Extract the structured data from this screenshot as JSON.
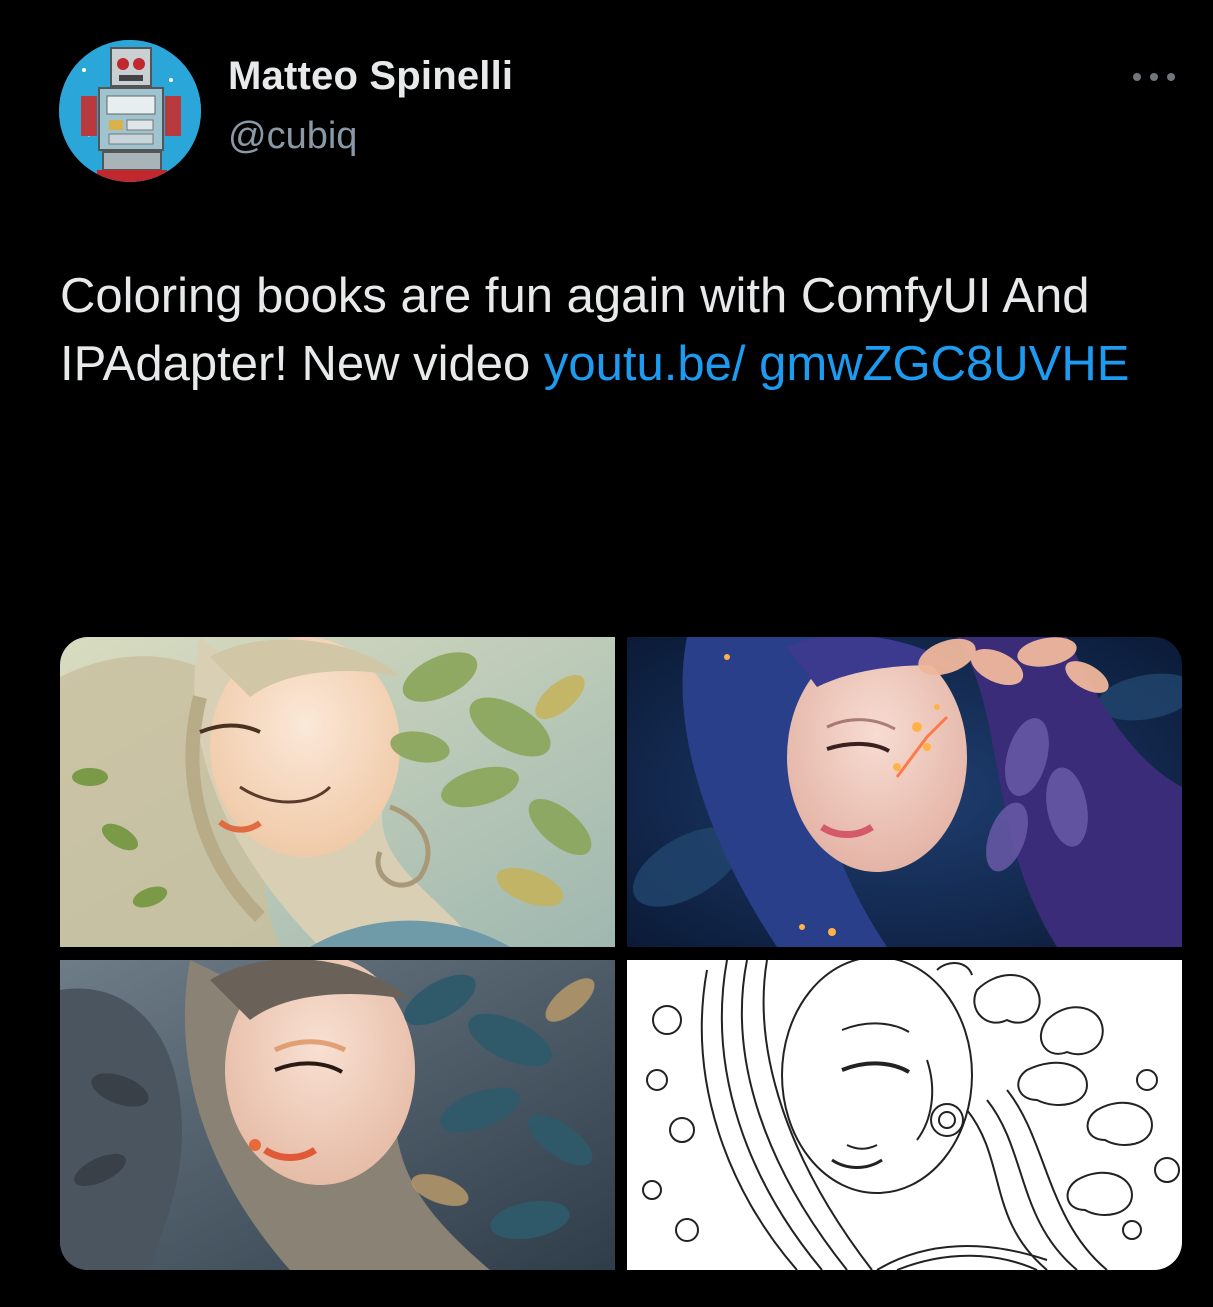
{
  "author": {
    "name": "Matteo Spinelli",
    "handle": "@cubiq",
    "avatar_icon": "robot-avatar-icon"
  },
  "menu_icon": "more-options-icon",
  "tweet": {
    "text_before_link": "Coloring books are fun again with ComfyUI And IPAdapter! New video ",
    "link_text": "youtu.be/ gmwZGC8UVHE"
  },
  "media": [
    {
      "name": "media-image-1",
      "style": "watercolor leaves, cream and green"
    },
    {
      "name": "media-image-2",
      "style": "dark blue with glowing flowers"
    },
    {
      "name": "media-image-3",
      "style": "muted grey-blue leaves"
    },
    {
      "name": "media-image-4",
      "style": "black and white line art"
    }
  ],
  "colors": {
    "background": "#000000",
    "text": "#e7e9ea",
    "secondary": "#8b98a5",
    "link": "#1d9bf0"
  }
}
